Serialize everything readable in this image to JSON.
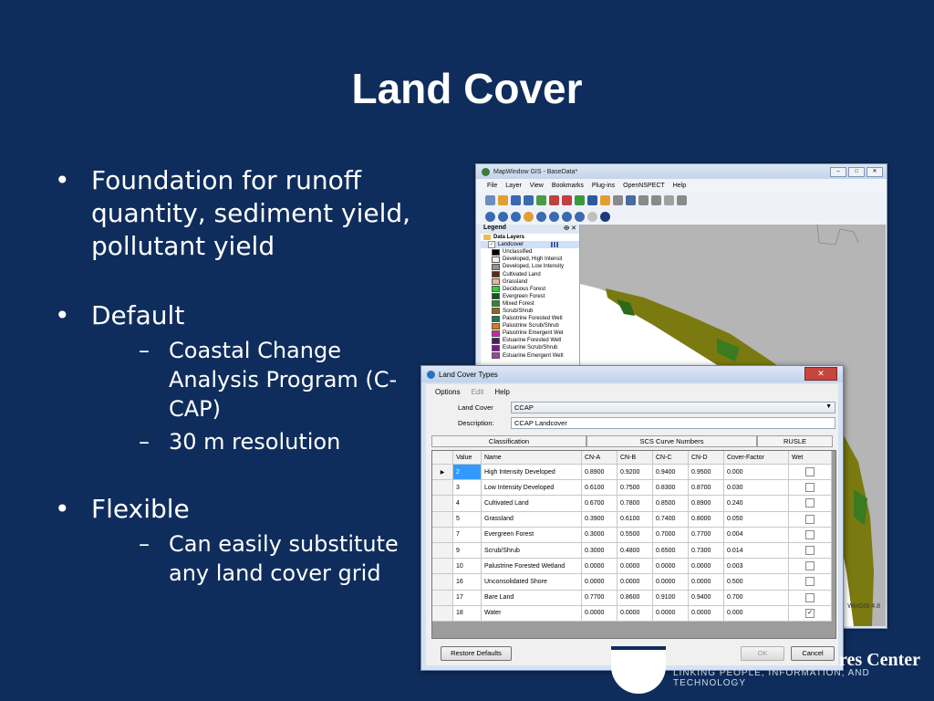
{
  "slide": {
    "title": "Land Cover",
    "bullets": [
      {
        "text": "Foundation for runoff quantity, sediment yield, pollutant yield",
        "sub": []
      },
      {
        "text": "Default",
        "sub": [
          "Coastal Change Analysis Program (C-CAP)",
          "30 m resolution"
        ]
      },
      {
        "text": "Flexible",
        "sub": [
          "Can easily substitute any land cover grid"
        ]
      }
    ],
    "bullet_glyph": "•",
    "dash_glyph": "–",
    "footer_title": "res Center",
    "footer_sub": "LINKING PEOPLE, INFORMATION, AND TECHNOLOGY"
  },
  "mapwindow": {
    "title": "MapWindow GIS - BaseData*",
    "menu": [
      "File",
      "Layer",
      "View",
      "Bookmarks",
      "Plug-ins",
      "OpenNSPECT",
      "Help"
    ],
    "legend_title": "Legend",
    "legend_pin": "ⴲ ✕",
    "data_layers": "Data Layers",
    "layer_name": "Landcover",
    "classes": [
      {
        "label": "Unclassified",
        "color": "#000000"
      },
      {
        "label": "Developed, High Intensit",
        "color": "#f2f2f2"
      },
      {
        "label": "Developed, Low Intensity",
        "color": "#9c8f90"
      },
      {
        "label": "Cultivated Land",
        "color": "#5a2a1a"
      },
      {
        "label": "Grassland",
        "color": "#e8b890"
      },
      {
        "label": "Deciduous Forest",
        "color": "#33cc33"
      },
      {
        "label": "Evergreen Forest",
        "color": "#0a5a1a"
      },
      {
        "label": "Mixed Forest",
        "color": "#2e8b2e"
      },
      {
        "label": "Scrub/Shrub",
        "color": "#8a6a1a"
      },
      {
        "label": "Palustrine Forested Wetl",
        "color": "#1a7a5a"
      },
      {
        "label": "Palustrine Scrub/Shrub",
        "color": "#e07a1a"
      },
      {
        "label": "Palustrine Emergent Wet",
        "color": "#cc2aa0"
      },
      {
        "label": "Estuarine Forested Wetl",
        "color": "#4a1a6a"
      },
      {
        "label": "Estuarine Scrub/Shrub",
        "color": "#7a1a8a"
      },
      {
        "label": "Estuarine Emergent Wetl",
        "color": "#aa3ab0"
      }
    ],
    "version": "WinGIS 4.8"
  },
  "dialog": {
    "title": "Land Cover Types",
    "close": "✕",
    "menu": [
      "Options",
      "Edit",
      "Help"
    ],
    "land_cover_label": "Land Cover",
    "land_cover_value": "CCAP",
    "description_label": "Description:",
    "description_value": "CCAP Landcover",
    "groups": [
      "Classification",
      "SCS Curve Numbers",
      "RUSLE"
    ],
    "columns": [
      "Value",
      "Name",
      "CN-A",
      "CN-B",
      "CN-C",
      "CN-D",
      "Cover-Factor",
      "Wet"
    ],
    "rows": [
      {
        "value": "2",
        "name": "High Intensity Developed",
        "a": "0.8900",
        "b": "0.9200",
        "c": "0.9400",
        "d": "0.9500",
        "cf": "0.000",
        "wet": ""
      },
      {
        "value": "3",
        "name": "Low Intensity Developed",
        "a": "0.6100",
        "b": "0.7500",
        "c": "0.8300",
        "d": "0.8700",
        "cf": "0.030",
        "wet": ""
      },
      {
        "value": "4",
        "name": "Cultivated Land",
        "a": "0.6700",
        "b": "0.7800",
        "c": "0.8500",
        "d": "0.8900",
        "cf": "0.240",
        "wet": ""
      },
      {
        "value": "5",
        "name": "Grassland",
        "a": "0.3900",
        "b": "0.6100",
        "c": "0.7400",
        "d": "0.8000",
        "cf": "0.050",
        "wet": ""
      },
      {
        "value": "7",
        "name": "Evergreen Forest",
        "a": "0.3000",
        "b": "0.5500",
        "c": "0.7000",
        "d": "0.7700",
        "cf": "0.004",
        "wet": ""
      },
      {
        "value": "9",
        "name": "Scrub/Shrub",
        "a": "0.3000",
        "b": "0.4800",
        "c": "0.6500",
        "d": "0.7300",
        "cf": "0.014",
        "wet": ""
      },
      {
        "value": "10",
        "name": "Palustrine Forested Wetland",
        "a": "0.0000",
        "b": "0.0000",
        "c": "0.0000",
        "d": "0.0000",
        "cf": "0.003",
        "wet": ""
      },
      {
        "value": "16",
        "name": "Unconsolidated Shore",
        "a": "0.0000",
        "b": "0.0000",
        "c": "0.0000",
        "d": "0.0000",
        "cf": "0.500",
        "wet": ""
      },
      {
        "value": "17",
        "name": "Bare Land",
        "a": "0.7700",
        "b": "0.8600",
        "c": "0.9100",
        "d": "0.9400",
        "cf": "0.700",
        "wet": ""
      },
      {
        "value": "18",
        "name": "Water",
        "a": "0.0000",
        "b": "0.0000",
        "c": "0.0000",
        "d": "0.0000",
        "cf": "0.000",
        "wet": "✓"
      }
    ],
    "current_row_marker": "▶",
    "restore_label": "Restore Defaults",
    "ok_label": "OK",
    "cancel_label": "Cancel"
  }
}
